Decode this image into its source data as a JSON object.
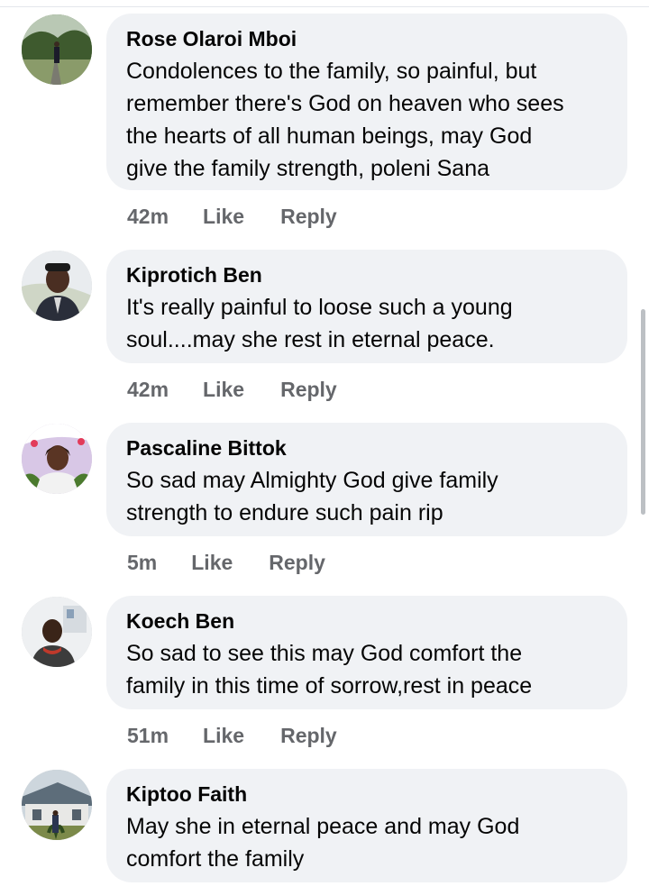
{
  "comments": [
    {
      "author": "Rose Olaroi Mboi",
      "text": "Condolences to the family, so painful, but\nremember there's God on heaven who sees\nthe hearts of all human beings, may God\ngive the family strength, poleni Sana",
      "time": "42m",
      "like": "Like",
      "reply": "Reply"
    },
    {
      "author": "Kiprotich Ben",
      "text": "It's really painful to loose such a young\nsoul....may she rest in eternal peace.",
      "time": "42m",
      "like": "Like",
      "reply": "Reply"
    },
    {
      "author": "Pascaline Bittok",
      "text": "So sad may Almighty God  give family\nstrength to endure such pain rip",
      "time": "5m",
      "like": "Like",
      "reply": "Reply"
    },
    {
      "author": "Koech Ben",
      "text": "So sad to see this may God comfort the\nfamily in this time of sorrow,rest in peace",
      "time": "51m",
      "like": "Like",
      "reply": "Reply"
    },
    {
      "author": "Kiptoo Faith",
      "text": "May she in eternal peace and may God\ncomfort the family",
      "time": "",
      "like": "",
      "reply": ""
    }
  ],
  "colors": {
    "bubble": "#f0f2f5",
    "meta": "#65676b",
    "text": "#050505"
  }
}
